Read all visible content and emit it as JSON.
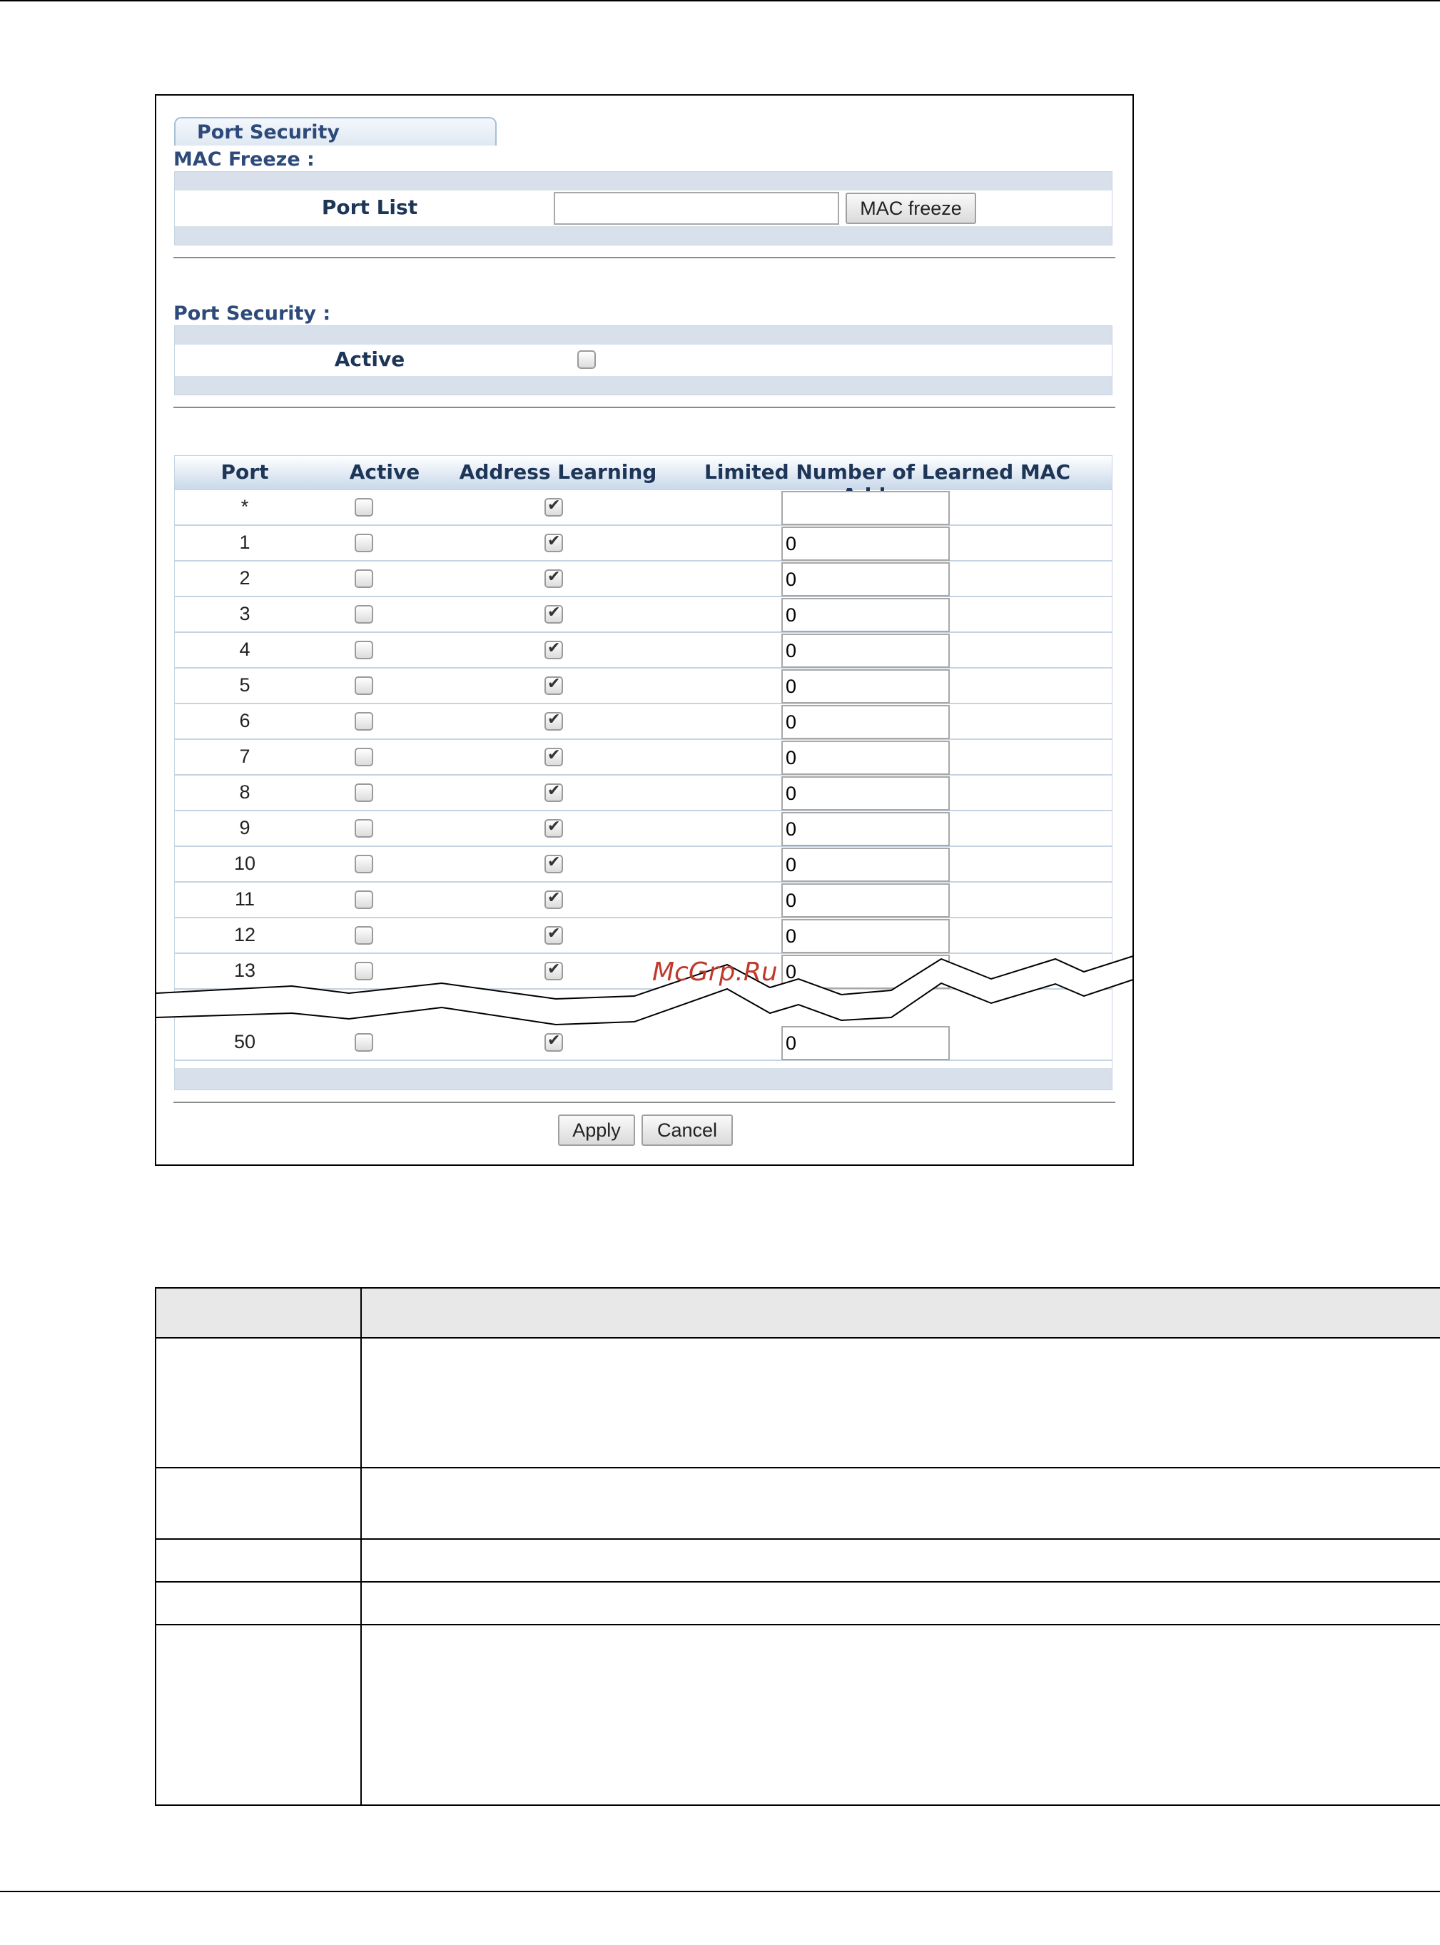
{
  "tab": {
    "label": "Port Security"
  },
  "mac_freeze": {
    "title": "MAC Freeze :",
    "port_list_label": "Port List",
    "port_list_value": "",
    "button_label": "MAC freeze"
  },
  "port_security": {
    "title": "Port Security :",
    "active_label": "Active",
    "active_checked": false
  },
  "table": {
    "headers": {
      "port": "Port",
      "active": "Active",
      "address_learning": "Address Learning",
      "limit": "Limited Number of Learned MAC Address"
    },
    "rows": [
      {
        "port": "*",
        "active": false,
        "learning": true,
        "limit": ""
      },
      {
        "port": "1",
        "active": false,
        "learning": true,
        "limit": "0"
      },
      {
        "port": "2",
        "active": false,
        "learning": true,
        "limit": "0"
      },
      {
        "port": "3",
        "active": false,
        "learning": true,
        "limit": "0"
      },
      {
        "port": "4",
        "active": false,
        "learning": true,
        "limit": "0"
      },
      {
        "port": "5",
        "active": false,
        "learning": true,
        "limit": "0"
      },
      {
        "port": "6",
        "active": false,
        "learning": true,
        "limit": "0"
      },
      {
        "port": "7",
        "active": false,
        "learning": true,
        "limit": "0"
      },
      {
        "port": "8",
        "active": false,
        "learning": true,
        "limit": "0"
      },
      {
        "port": "9",
        "active": false,
        "learning": true,
        "limit": "0"
      },
      {
        "port": "10",
        "active": false,
        "learning": true,
        "limit": "0"
      },
      {
        "port": "11",
        "active": false,
        "learning": true,
        "limit": "0"
      },
      {
        "port": "12",
        "active": false,
        "learning": true,
        "limit": "0"
      },
      {
        "port": "13",
        "active": false,
        "learning": true,
        "limit": "0"
      }
    ],
    "last_row": {
      "port": "50",
      "active": false,
      "learning": true,
      "limit": "0"
    }
  },
  "buttons": {
    "apply": "Apply",
    "cancel": "Cancel"
  },
  "watermark": "McGrp.Ru"
}
